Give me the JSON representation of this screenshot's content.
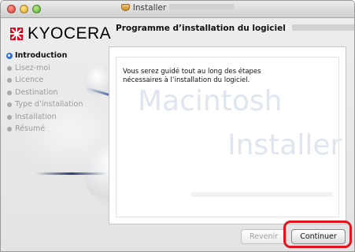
{
  "window": {
    "title": "Installer",
    "app_icon": "installer-box-icon"
  },
  "sidebar": {
    "logo_text": "KYOCERA",
    "steps": [
      {
        "label": "Introduction",
        "active": true
      },
      {
        "label": "Lisez-moi",
        "active": false
      },
      {
        "label": "Licence",
        "active": false
      },
      {
        "label": "Destination",
        "active": false
      },
      {
        "label": "Type d’installation",
        "active": false
      },
      {
        "label": "Installation",
        "active": false
      },
      {
        "label": "Résumé",
        "active": false
      }
    ]
  },
  "main": {
    "heading": "Programme d’installation du logiciel",
    "description_line1": "Vous serez guidé tout au long des étapes",
    "description_line2": "nécessaires à l’installation du logiciel.",
    "watermark_line1": "Macintosh",
    "watermark_line2": "Installer"
  },
  "buttons": {
    "back_label": "Revenir",
    "continue_label": "Continuer"
  },
  "colors": {
    "accent": "#2f73d9",
    "highlight": "#e0151d",
    "logo_red": "#e2001a"
  }
}
